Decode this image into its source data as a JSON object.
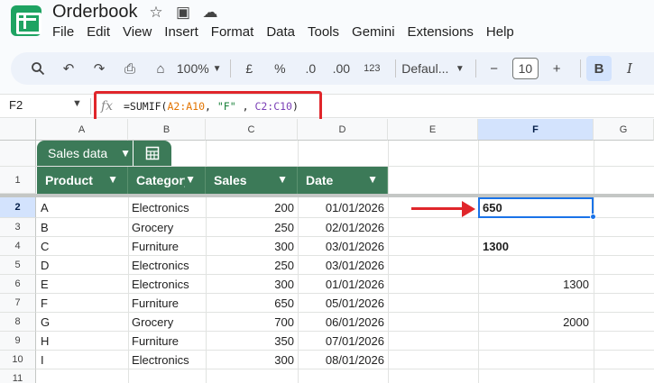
{
  "app": {
    "title": "Orderbook",
    "title_icons": [
      "star-icon",
      "move-to-folder-icon",
      "cloud-status-icon"
    ]
  },
  "menu": [
    "File",
    "Edit",
    "View",
    "Insert",
    "Format",
    "Data",
    "Tools",
    "Gemini",
    "Extensions",
    "Help"
  ],
  "toolbar": {
    "zoom": "100%",
    "currency": "£",
    "percent": "%",
    "decrease_decimal": ".0",
    "increase_decimal": ".00",
    "more_formats": "123",
    "font": "Defaul...",
    "font_size": "10",
    "bold": "B",
    "italic": "I"
  },
  "formula_bar": {
    "cell_ref": "F2",
    "fx": "fx",
    "formula_prefix": "=SUMIF(",
    "range1": "A2:A10",
    "sep1": ", ",
    "criterion": "\"F\"",
    "sep2": " , ",
    "range2": "C2:C10",
    "formula_suffix": ")"
  },
  "columns": [
    "A",
    "B",
    "C",
    "D",
    "E",
    "F",
    "G"
  ],
  "rows": [
    "1",
    "2",
    "3",
    "4",
    "5",
    "6",
    "7",
    "8",
    "9",
    "10",
    "11"
  ],
  "selected_cell": "F2",
  "table": {
    "name": "Sales data",
    "headers": [
      "Product",
      "Category",
      "Sales",
      "Date"
    ],
    "rows": [
      [
        "A",
        "Electronics",
        "200",
        "01/01/2026"
      ],
      [
        "B",
        "Grocery",
        "250",
        "02/01/2026"
      ],
      [
        "C",
        "Furniture",
        "300",
        "03/01/2026"
      ],
      [
        "D",
        "Electronics",
        "250",
        "03/01/2026"
      ],
      [
        "E",
        "Electronics",
        "300",
        "01/01/2026"
      ],
      [
        "F",
        "Furniture",
        "650",
        "05/01/2026"
      ],
      [
        "G",
        "Grocery",
        "700",
        "06/01/2026"
      ],
      [
        "H",
        "Furniture",
        "350",
        "07/01/2026"
      ],
      [
        "I",
        "Electronics",
        "300",
        "08/01/2026"
      ]
    ]
  },
  "column_f": {
    "f2": "650",
    "f4": "1300",
    "f6": "1300",
    "f8": "2000"
  },
  "colors": {
    "table_header": "#3c7a58",
    "selection": "#1a73e8",
    "annotation_red": "#e0262b",
    "range1_color": "#e37400",
    "criterion_color": "#188038",
    "range2_color": "#7b3fb6"
  }
}
